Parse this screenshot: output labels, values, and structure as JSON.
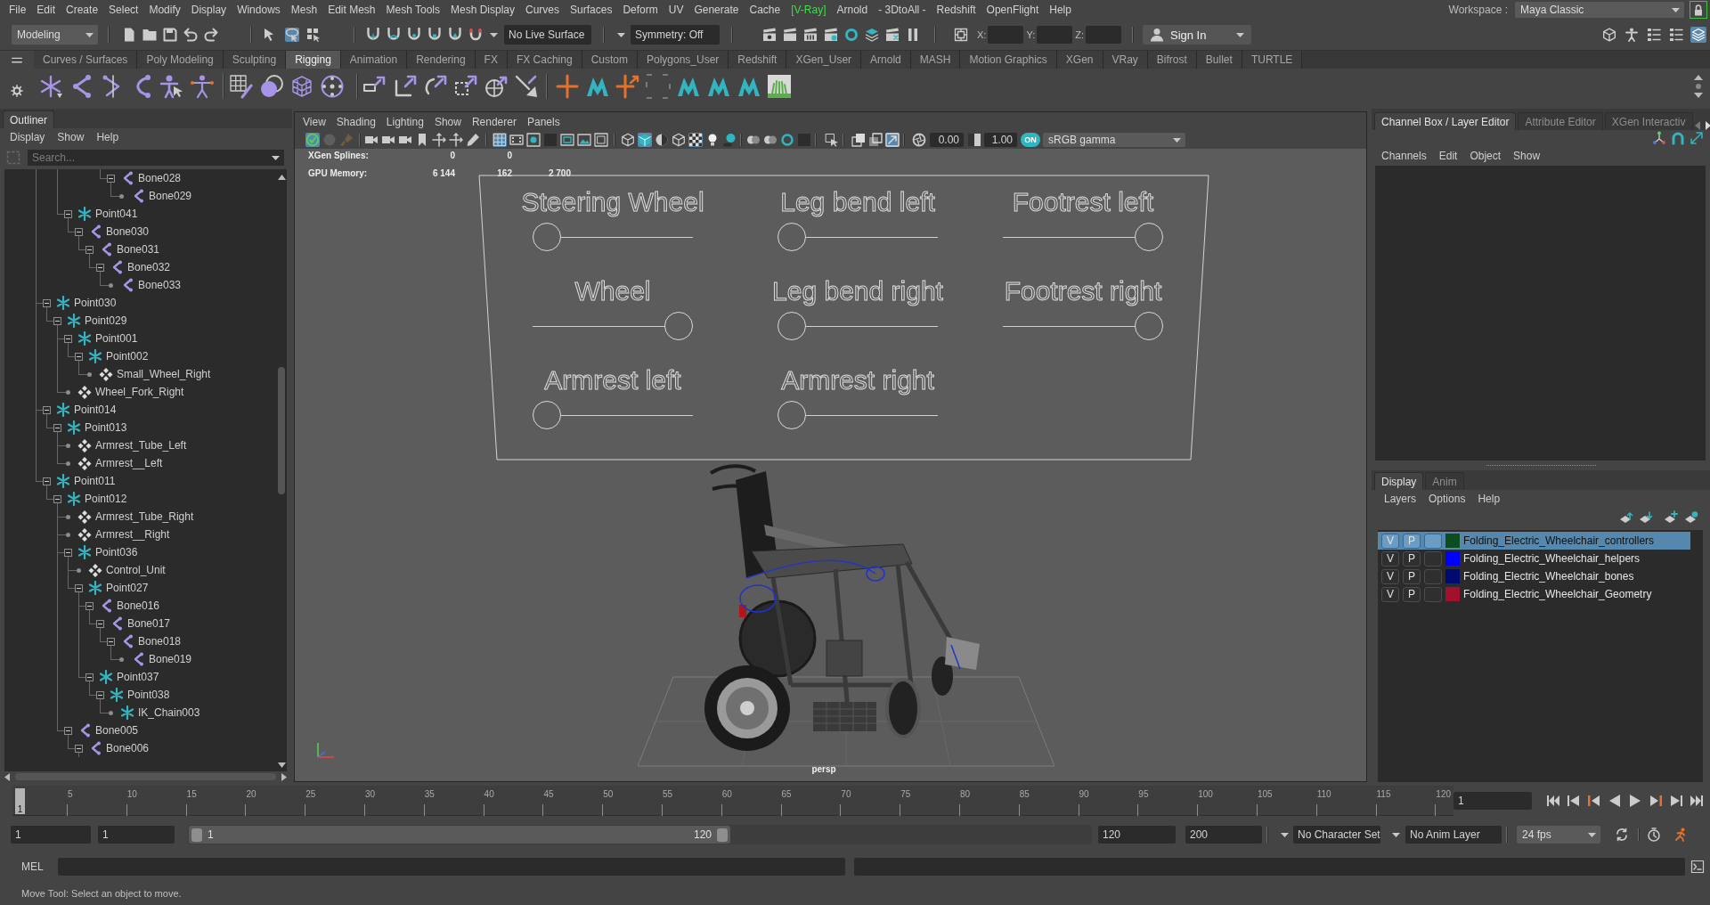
{
  "menu_bar": {
    "items": [
      {
        "label": "File",
        "highlighted": false
      },
      {
        "label": "Edit",
        "highlighted": false
      },
      {
        "label": "Create",
        "highlighted": false
      },
      {
        "label": "Select",
        "highlighted": false
      },
      {
        "label": "Modify",
        "highlighted": false
      },
      {
        "label": "Display",
        "highlighted": false
      },
      {
        "label": "Windows",
        "highlighted": false
      },
      {
        "label": "Mesh",
        "highlighted": false
      },
      {
        "label": "Edit Mesh",
        "highlighted": false
      },
      {
        "label": "Mesh Tools",
        "highlighted": false
      },
      {
        "label": "Mesh Display",
        "highlighted": false
      },
      {
        "label": "Curves",
        "highlighted": false
      },
      {
        "label": "Surfaces",
        "highlighted": false
      },
      {
        "label": "Deform",
        "highlighted": false
      },
      {
        "label": "UV",
        "highlighted": false
      },
      {
        "label": "Generate",
        "highlighted": false
      },
      {
        "label": "Cache",
        "highlighted": false
      },
      {
        "label": "[V-Ray]",
        "highlighted": true
      },
      {
        "label": "Arnold",
        "highlighted": false
      },
      {
        "label": "- 3DtoAll -",
        "highlighted": false
      },
      {
        "label": "Redshift",
        "highlighted": false
      },
      {
        "label": "OpenFlight",
        "highlighted": false
      },
      {
        "label": "Help",
        "highlighted": false
      }
    ]
  },
  "workspace": {
    "label": "Workspace :",
    "value": "Maya Classic",
    "locked": true
  },
  "status_line": {
    "mode": "Modeling",
    "select_tools": [
      {
        "on": false
      },
      {
        "on": true
      },
      {
        "on": false
      }
    ],
    "live_surface": "No Live Surface",
    "symmetry": "Symmetry: Off",
    "coordinates": [
      {
        "label": "X:"
      },
      {
        "label": "Y:"
      },
      {
        "label": "Z:"
      }
    ],
    "sign_in": "Sign In",
    "panel_toggles": [
      {
        "on": false
      },
      {
        "on": false
      },
      {
        "on": false
      },
      {
        "on": false
      },
      {
        "on": true
      }
    ]
  },
  "shelf": {
    "tabs": [
      {
        "label": "Curves / Surfaces",
        "selected": false
      },
      {
        "label": "Poly Modeling",
        "selected": false
      },
      {
        "label": "Sculpting",
        "selected": false
      },
      {
        "label": "Rigging",
        "selected": true
      },
      {
        "label": "Animation",
        "selected": false
      },
      {
        "label": "Rendering",
        "selected": false
      },
      {
        "label": "FX",
        "selected": false
      },
      {
        "label": "FX Caching",
        "selected": false
      },
      {
        "label": "Custom",
        "selected": false
      },
      {
        "label": "Polygons_User",
        "selected": false
      },
      {
        "label": "Redshift",
        "selected": false
      },
      {
        "label": "XGen_User",
        "selected": false
      },
      {
        "label": "Arnold",
        "selected": false
      },
      {
        "label": "MASH",
        "selected": false
      },
      {
        "label": "Motion Graphics",
        "selected": false
      },
      {
        "label": "XGen",
        "selected": false
      },
      {
        "label": "VRay",
        "selected": false
      },
      {
        "label": "Bifrost",
        "selected": false
      },
      {
        "label": "Bullet",
        "selected": false
      },
      {
        "label": "TURTLE",
        "selected": false
      }
    ]
  },
  "outliner": {
    "title": "Outliner",
    "menu": [
      "Display",
      "Show",
      "Help"
    ],
    "search": {
      "placeholder": "Search..."
    },
    "tree": [
      {
        "children": [
          {
            "children": [
              {
                "children": [
                  {
                    "children": [
                      {
                        "children": [
                          {
                            "children": [
                              {
                                "label": "Bone028",
                                "kind": "joint",
                                "expanded": true,
                                "children": [
                                  {
                                    "label": "Bone029",
                                    "kind": "joint"
                                  }
                                ]
                              }
                            ]
                          }
                        ]
                      }
                    ]
                  }
                ]
              },
              {
                "label": "Point041",
                "kind": "locator",
                "expanded": true,
                "children": [
                  {
                    "label": "Bone030",
                    "kind": "joint",
                    "expanded": true,
                    "children": [
                      {
                        "label": "Bone031",
                        "kind": "joint",
                        "expanded": true,
                        "children": [
                          {
                            "label": "Bone032",
                            "kind": "joint",
                            "expanded": true,
                            "children": [
                              {
                                "label": "Bone033",
                                "kind": "joint"
                              }
                            ]
                          }
                        ]
                      }
                    ]
                  }
                ]
              }
            ]
          }
        ]
      },
      {
        "label": "Point030",
        "kind": "locator",
        "expanded": true,
        "children": [
          {
            "label": "Point029",
            "kind": "locator",
            "expanded": true,
            "children": [
              {
                "label": "Point001",
                "kind": "locator",
                "expanded": true,
                "children": [
                  {
                    "label": "Point002",
                    "kind": "locator",
                    "expanded": true,
                    "children": [
                      {
                        "label": "Small_Wheel_Right",
                        "kind": "mesh"
                      }
                    ]
                  }
                ]
              },
              {
                "label": "Wheel_Fork_Right",
                "kind": "mesh"
              }
            ]
          }
        ]
      },
      {
        "label": "Point014",
        "kind": "locator",
        "expanded": true,
        "children": [
          {
            "label": "Point013",
            "kind": "locator",
            "expanded": true,
            "children": [
              {
                "label": "Armrest_Tube_Left",
                "kind": "mesh"
              },
              {
                "label": "Armrest__Left",
                "kind": "mesh"
              }
            ]
          }
        ]
      },
      {
        "label": "Point011",
        "kind": "locator",
        "expanded": true,
        "children": [
          {
            "label": "Point012",
            "kind": "locator",
            "expanded": true,
            "children": [
              {
                "label": "Armrest_Tube_Right",
                "kind": "mesh"
              },
              {
                "label": "Armrest__Right",
                "kind": "mesh"
              },
              {
                "label": "Point036",
                "kind": "locator",
                "expanded": true,
                "children": [
                  {
                    "label": "Control_Unit",
                    "kind": "mesh"
                  },
                  {
                    "label": "Point027",
                    "kind": "locator",
                    "expanded": true,
                    "children": [
                      {
                        "label": "Bone016",
                        "kind": "joint",
                        "expanded": true,
                        "children": [
                          {
                            "label": "Bone017",
                            "kind": "joint",
                            "expanded": true,
                            "children": [
                              {
                                "label": "Bone018",
                                "kind": "joint",
                                "expanded": true,
                                "children": [
                                  {
                                    "label": "Bone019",
                                    "kind": "joint"
                                  }
                                ]
                              }
                            ]
                          }
                        ]
                      },
                      {
                        "label": "Point037",
                        "kind": "locator",
                        "expanded": true,
                        "children": [
                          {
                            "label": "Point038",
                            "kind": "locator",
                            "expanded": true,
                            "children": [
                              {
                                "label": "IK_Chain003",
                                "kind": "locator"
                              }
                            ]
                          }
                        ]
                      }
                    ]
                  }
                ]
              },
              {
                "label": "Bone005",
                "kind": "joint",
                "expanded": true,
                "children": [
                  {
                    "label": "Bone006",
                    "kind": "joint",
                    "expanded": true
                  }
                ]
              }
            ]
          }
        ]
      }
    ]
  },
  "viewport": {
    "menu": [
      "View",
      "Shading",
      "Lighting",
      "Show",
      "Renderer",
      "Panels"
    ],
    "toolbar_groups": [
      [
        {
          "on": true
        },
        {
          "on": false
        },
        {
          "on": false
        }
      ],
      [
        {
          "on": false
        },
        {
          "on": false
        },
        {
          "on": false
        },
        {
          "on": false
        },
        {
          "on": false
        },
        {
          "on": false
        },
        {
          "on": false
        }
      ],
      [
        {
          "on": true
        },
        {
          "on": false
        },
        {
          "on": false
        },
        {
          "on": false
        },
        {
          "on": false
        },
        {
          "on": false
        },
        {
          "on": false
        }
      ],
      [
        {
          "on": false
        },
        {
          "on": true
        },
        {
          "on": false
        },
        {
          "on": false
        },
        {
          "on": true
        },
        {
          "on": false
        },
        {
          "on": false
        }
      ],
      [
        {
          "on": false
        },
        {
          "on": false
        },
        {
          "on": false
        },
        {
          "on": false
        }
      ],
      [
        {
          "on": false
        }
      ],
      [
        {
          "on": false
        },
        {
          "on": false
        },
        {
          "on": true
        }
      ]
    ],
    "exposure": "0.00",
    "gamma": "1.00",
    "view_transform_toggle": "ON",
    "color_space": "sRGB gamma",
    "hud": [
      {
        "label": "XGen Splines:",
        "values": [
          "0",
          "0"
        ]
      },
      {
        "label": "GPU Memory:",
        "values": [
          "6 144",
          "162",
          "2 700"
        ]
      }
    ],
    "controls": [
      {
        "label": "Steering Wheel",
        "level": 0
      },
      {
        "label": "Leg bend left",
        "level": 0
      },
      {
        "label": "Footrest left",
        "level": 1
      },
      {
        "label": "Wheel",
        "level": 1
      },
      {
        "label": "Leg bend right",
        "level": 0
      },
      {
        "label": "Footrest right",
        "level": 1
      },
      {
        "label": "Armrest left",
        "level": 0
      },
      {
        "label": "Armrest right",
        "level": 0
      }
    ],
    "camera": "persp"
  },
  "right_panel": {
    "tabs": [
      {
        "label": "Channel Box / Layer Editor",
        "selected": true
      },
      {
        "label": "Attribute Editor",
        "selected": false
      },
      {
        "label": "XGen Interactiv",
        "selected": false
      }
    ],
    "channel_menu": [
      "Channels",
      "Edit",
      "Object",
      "Show"
    ],
    "layer_tabs": [
      {
        "label": "Display",
        "selected": true
      },
      {
        "label": "Anim",
        "selected": false
      }
    ],
    "layer_menu": [
      "Layers",
      "Options",
      "Help"
    ],
    "layers": [
      {
        "visibility": "V",
        "playback": "P",
        "name": "Folding_Electric_Wheelchair_controllers",
        "color": "#0b4d1f",
        "selected": true
      },
      {
        "visibility": "V",
        "playback": "P",
        "name": "Folding_Electric_Wheelchair_helpers",
        "color": "#0000ff",
        "selected": false
      },
      {
        "visibility": "V",
        "playback": "P",
        "name": "Folding_Electric_Wheelchair_bones",
        "color": "#000a70",
        "selected": false
      },
      {
        "visibility": "V",
        "playback": "P",
        "name": "Folding_Electric_Wheelchair_Geometry",
        "color": "#a3102e",
        "selected": false
      }
    ]
  },
  "timeline": {
    "frame_labels": [
      "5",
      "10",
      "15",
      "20",
      "25",
      "30",
      "35",
      "40",
      "45",
      "50",
      "55",
      "60",
      "65",
      "70",
      "75",
      "80",
      "85",
      "90",
      "95",
      "100",
      "105",
      "110",
      "115",
      "120"
    ],
    "current_frame": "1",
    "frame_field": "1"
  },
  "range_slider": {
    "start": "1",
    "playback_start": "1",
    "slider_start": "1",
    "slider_end": "120",
    "level": 0.6,
    "playback_end": "120",
    "end": "200",
    "character_set": "No Character Set",
    "anim_layer": "No Anim Layer",
    "fps": "24 fps"
  },
  "command_line": {
    "language": "MEL"
  },
  "help_line": {
    "text": "Move Tool: Select an object to move."
  }
}
